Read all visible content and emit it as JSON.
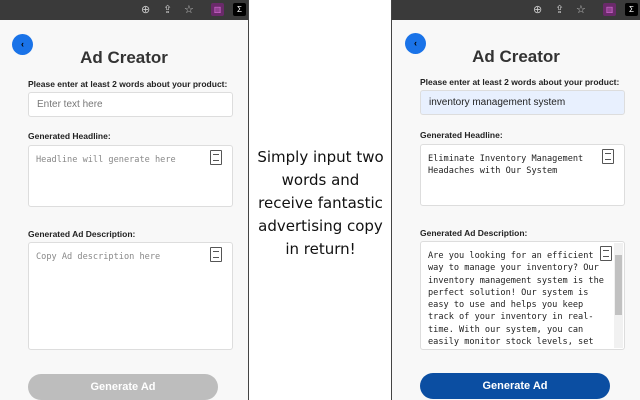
{
  "caption": [
    "Simply input two",
    "words and",
    "receive fantastic",
    "advertising copy",
    "in return!"
  ],
  "panels": {
    "before": {
      "title": "Ad Creator",
      "prompt_label": "Please enter at least 2 words about your product:",
      "input_placeholder": "Enter text here",
      "input_value": "",
      "headline_label": "Generated Headline:",
      "headline_placeholder": "Headline will generate here",
      "description_label": "Generated Ad Description:",
      "description_placeholder": "Copy Ad description here",
      "button": "Generate Ad",
      "button_color": "#bdbdbd"
    },
    "after": {
      "title": "Ad Creator",
      "prompt_label": "Please enter at least 2 words about your product:",
      "input_value": "inventory management system",
      "headline_label": "Generated Headline:",
      "headline": "Eliminate Inventory Management Headaches with Our System",
      "description_label": "Generated Ad Description:",
      "description": "Are you looking for an efficient way to manage your inventory? Our inventory management system is the perfect solution! Our system is easy to use and helps you keep track of your inventory in real-time. With our system, you can easily monitor stock levels, set reorder points, and track orders.",
      "button": "Generate Ad",
      "button_color": "#0b4ea2"
    }
  }
}
